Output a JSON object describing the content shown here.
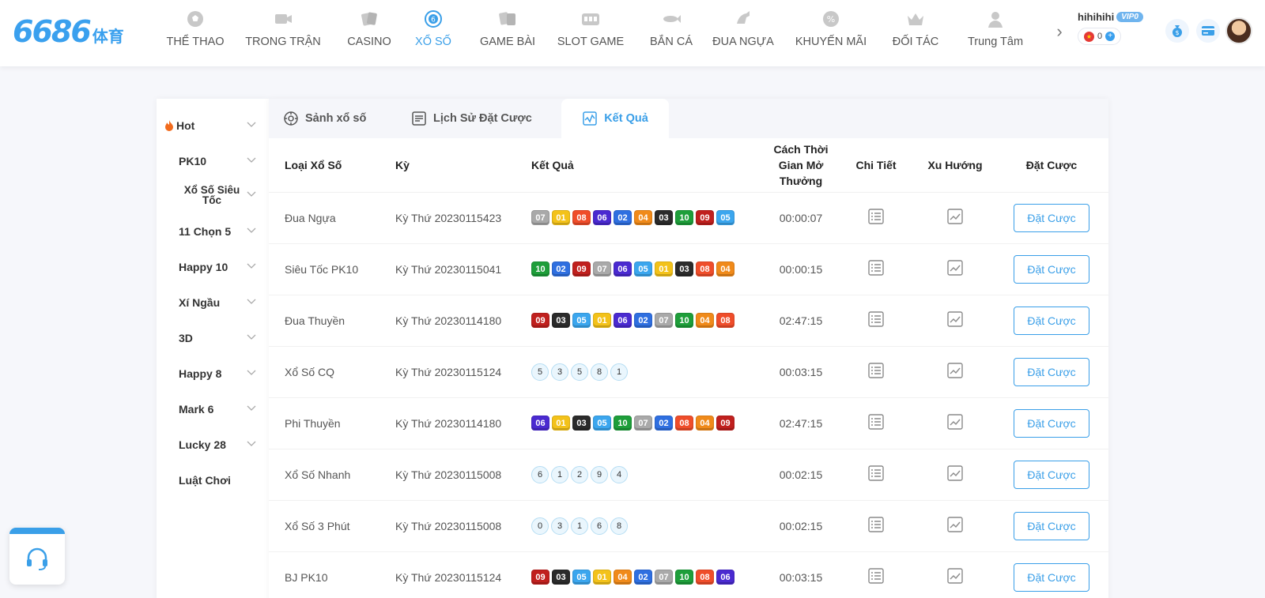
{
  "logo": {
    "num": "6686",
    "sub": "体育"
  },
  "nav": [
    {
      "label": "THỂ THAO",
      "icon": "soccer-ball-icon"
    },
    {
      "label": "TRONG TRẬN",
      "icon": "video-camera-icon"
    },
    {
      "label": "CASINO",
      "icon": "playing-cards-icon"
    },
    {
      "label": "XỔ SỐ",
      "icon": "lottery-ball-icon",
      "active": true
    },
    {
      "label": "GAME BÀI",
      "icon": "card-game-icon"
    },
    {
      "label": "SLOT GAME",
      "icon": "slot-machine-icon"
    },
    {
      "label": "BẮN CÁ",
      "icon": "fish-icon"
    },
    {
      "label": "ĐUA NGỰA",
      "icon": "horse-icon"
    },
    {
      "label": "KHUYẾN MÃI",
      "icon": "percent-badge-icon"
    },
    {
      "label": "ĐỐI TÁC",
      "icon": "crown-icon"
    },
    {
      "label": "Trung Tâm",
      "icon": "user-icon"
    }
  ],
  "user": {
    "name": "hihihihi",
    "vip": "VIP0",
    "balance": "0"
  },
  "sidebar": {
    "items": [
      {
        "label": "Hot",
        "hot": true
      },
      {
        "label": "PK10"
      },
      {
        "label": "Xổ Số Siêu Tốc"
      },
      {
        "label": "11 Chọn 5"
      },
      {
        "label": "Happy 10"
      },
      {
        "label": "Xí Ngầu"
      },
      {
        "label": "3D"
      },
      {
        "label": "Happy 8"
      },
      {
        "label": "Mark 6"
      },
      {
        "label": "Lucky 28"
      },
      {
        "label": "Luật Chơi"
      }
    ]
  },
  "tabs": [
    {
      "label": "Sảnh xổ số",
      "icon": "lottery-hall-icon"
    },
    {
      "label": "Lịch Sử Đặt Cược",
      "icon": "history-list-icon"
    },
    {
      "label": "Kết Quả",
      "icon": "result-chart-icon",
      "active": true
    }
  ],
  "table": {
    "headers": [
      "Loại Xổ Số",
      "Kỳ",
      "Kết Quả",
      "Cách Thời Gian Mở Thưởng",
      "Chi Tiết",
      "Xu Hướng",
      "Đặt Cược"
    ],
    "bet_label": "Đặt Cược",
    "rows": [
      {
        "name": "Đua Ngựa",
        "period": "Kỳ Thứ 20230115423",
        "time": "00:00:07",
        "style": "box",
        "balls": [
          "07",
          "01",
          "08",
          "06",
          "02",
          "04",
          "03",
          "10",
          "09",
          "05"
        ]
      },
      {
        "name": "Siêu Tốc PK10",
        "period": "Kỳ Thứ 20230115041",
        "time": "00:00:15",
        "style": "box",
        "balls": [
          "10",
          "02",
          "09",
          "07",
          "06",
          "05",
          "01",
          "03",
          "08",
          "04"
        ]
      },
      {
        "name": "Đua Thuyền",
        "period": "Kỳ Thứ 20230114180",
        "time": "02:47:15",
        "style": "box",
        "balls": [
          "09",
          "03",
          "05",
          "01",
          "06",
          "02",
          "07",
          "10",
          "04",
          "08"
        ]
      },
      {
        "name": "Xổ Số CQ",
        "period": "Kỳ Thứ 20230115124",
        "time": "00:03:15",
        "style": "circle",
        "balls": [
          "5",
          "3",
          "5",
          "8",
          "1"
        ]
      },
      {
        "name": "Phi Thuyền",
        "period": "Kỳ Thứ 20230114180",
        "time": "02:47:15",
        "style": "box",
        "balls": [
          "06",
          "01",
          "03",
          "05",
          "10",
          "07",
          "02",
          "08",
          "04",
          "09"
        ]
      },
      {
        "name": "Xổ Số Nhanh",
        "period": "Kỳ Thứ 20230115008",
        "time": "00:02:15",
        "style": "circle",
        "balls": [
          "6",
          "1",
          "2",
          "9",
          "4"
        ]
      },
      {
        "name": "Xổ Số 3 Phút",
        "period": "Kỳ Thứ 20230115008",
        "time": "00:02:15",
        "style": "circle",
        "balls": [
          "0",
          "3",
          "1",
          "6",
          "8"
        ]
      },
      {
        "name": "BJ PK10",
        "period": "Kỳ Thứ 20230115124",
        "time": "00:03:15",
        "style": "box",
        "balls": [
          "09",
          "03",
          "05",
          "01",
          "04",
          "02",
          "07",
          "10",
          "08",
          "06"
        ]
      }
    ]
  },
  "ball_colors": {
    "01": "#f3c21a",
    "02": "#2f6fe0",
    "03": "#2b2b2b",
    "04": "#f08a1a",
    "05": "#3ba6ee",
    "06": "#4a2ad0",
    "07": "#a9a9a9",
    "08": "#ef4d2a",
    "09": "#c0201e",
    "10": "#1e9e3a"
  },
  "colors": {
    "accent": "#3a9fe8"
  }
}
